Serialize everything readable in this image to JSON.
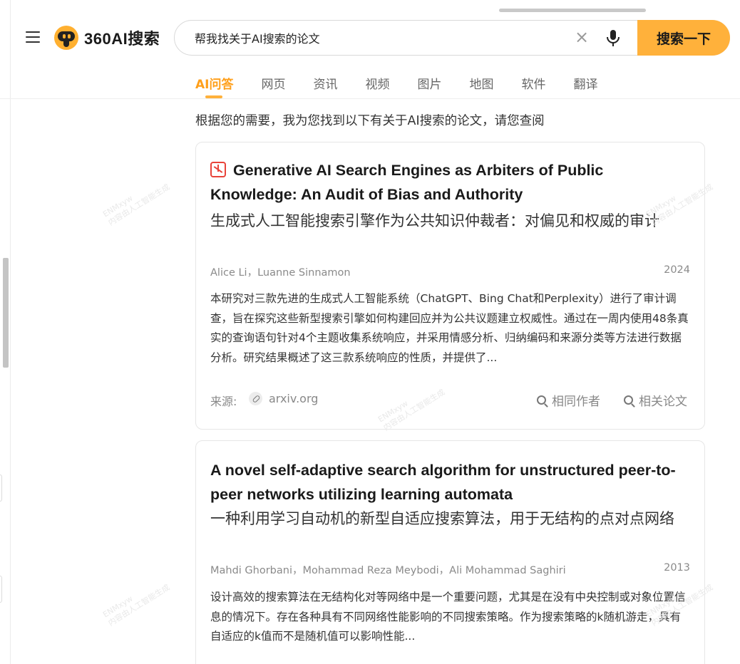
{
  "header": {
    "logo_text": "360AI搜索",
    "search_value": "帮我找关于AI搜索的论文",
    "clear_symbol": "×",
    "search_button": "搜索一下"
  },
  "tabs": [
    {
      "label": "AI问答",
      "active": true
    },
    {
      "label": "网页"
    },
    {
      "label": "资讯"
    },
    {
      "label": "视频"
    },
    {
      "label": "图片"
    },
    {
      "label": "地图"
    },
    {
      "label": "软件"
    },
    {
      "label": "翻译"
    }
  ],
  "intro": "根据您的需要，我为您找到以下有关于AI搜索的论文，请您查阅",
  "results": [
    {
      "title_en": "Generative AI Search Engines as Arbiters of Public Knowledge: An Audit of Bias and Authority",
      "title_cn": "生成式人工智能搜索引擎作为公共知识仲裁者：对偏见和权威的审计",
      "authors": "Alice Li，Luanne Sinnamon",
      "year": "2024",
      "abstract": "本研究对三款先进的生成式人工智能系统（ChatGPT、Bing Chat和Perplexity）进行了审计调查，旨在探究这些新型搜索引擎如何构建回应并为公共议题建立权威性。通过在一周内使用48条真实的查询语句针对4个主题收集系统响应，并采用情感分析、归纳编码和来源分类等方法进行数据分析。研究结果概述了这三款系统响应的性质，并提供了...",
      "source_label": "来源:",
      "source": "arxiv.org",
      "action_same_author": "相同作者",
      "action_related": "相关论文"
    },
    {
      "title_en": "A novel self-adaptive search algorithm for unstructured peer-to-peer networks utilizing learning automata",
      "title_cn": "一种利用学习自动机的新型自适应搜索算法，用于无结构的点对点网络",
      "authors": "Mahdi Ghorbani，Mohammad Reza Meybodi，Ali Mohammad Saghiri",
      "year": "2013",
      "abstract": "设计高效的搜索算法在无结构化对等网络中是一个重要问题，尤其是在没有中央控制或对象位置信息的情况下。存在各种具有不同网络性能影响的不同搜索策略。作为搜索策略的k随机游走，具有自适应的k值而不是随机值可以影响性能..."
    }
  ],
  "watermark": {
    "line1": "ENMxyw",
    "line2": "内容由人工智能生成"
  },
  "colors": {
    "accent": "#ffb13b",
    "active_tab": "#ff9f1a",
    "pdf_icon": "#e8433a"
  }
}
